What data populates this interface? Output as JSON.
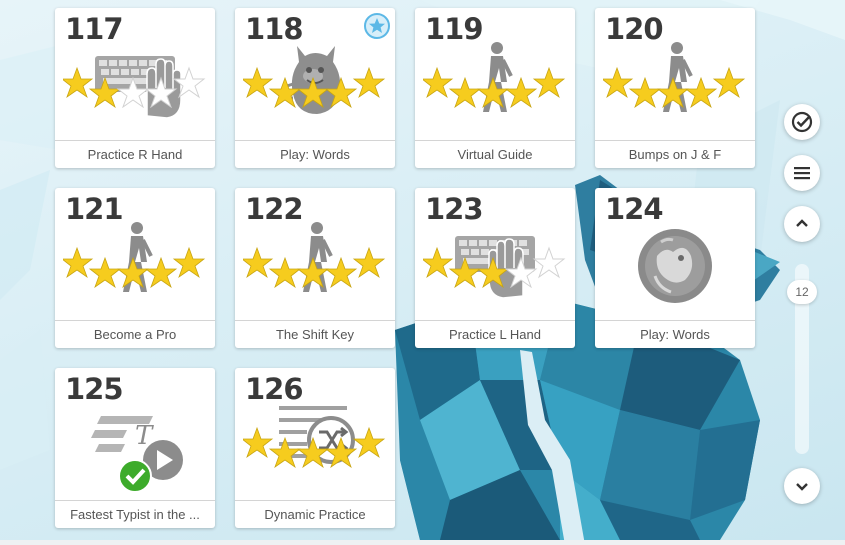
{
  "lessons": [
    {
      "number": "117",
      "title": "Practice R Hand",
      "icon": "keyboard-right-hand-icon",
      "stars": 2,
      "badge": false
    },
    {
      "number": "118",
      "title": "Play: Words",
      "icon": "monster-game-icon",
      "stars": 5,
      "badge": true
    },
    {
      "number": "119",
      "title": "Virtual Guide",
      "icon": "walking-person-icon",
      "stars": 5,
      "badge": false
    },
    {
      "number": "120",
      "title": "Bumps on J & F",
      "icon": "walking-person-icon",
      "stars": 5,
      "badge": false
    },
    {
      "number": "121",
      "title": "Become a Pro",
      "icon": "walking-person-icon",
      "stars": 5,
      "badge": false
    },
    {
      "number": "122",
      "title": "The Shift Key",
      "icon": "walking-person-icon",
      "stars": 5,
      "badge": false
    },
    {
      "number": "123",
      "title": "Practice L Hand",
      "icon": "keyboard-left-hand-icon",
      "stars": 3,
      "badge": false
    },
    {
      "number": "124",
      "title": "Play: Words",
      "icon": "locked-game-bubble-icon",
      "stars": 0,
      "badge": false
    },
    {
      "number": "125",
      "title": "Fastest Typist in the ...",
      "icon": "video-completed-icon",
      "stars": 0,
      "badge": false
    },
    {
      "number": "126",
      "title": "Dynamic Practice",
      "icon": "shuffle-text-icon",
      "stars": 5,
      "badge": false
    }
  ],
  "sidebar": {
    "check_icon": "check-circle-icon",
    "menu_icon": "hamburger-menu-icon",
    "up_icon": "chevron-up-icon",
    "down_icon": "chevron-down-icon",
    "scroll_position": "12"
  },
  "colors": {
    "star_fill": "#f6cc1e",
    "star_empty": "#ffffff",
    "icon_gray": "#8c8c8c",
    "check_green": "#3dab2b",
    "badge_blue": "#5cb8e6"
  }
}
